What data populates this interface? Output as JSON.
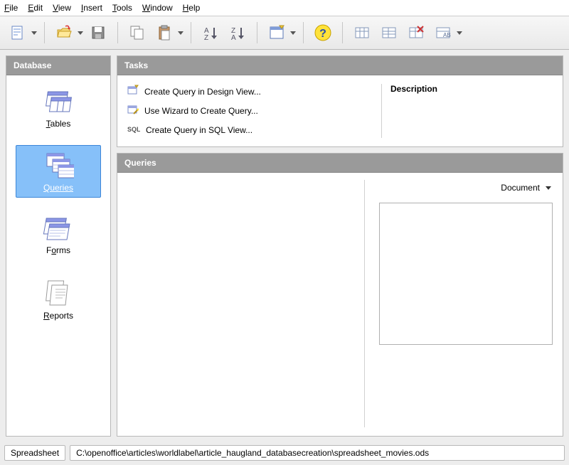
{
  "menu": {
    "file": "File",
    "edit": "Edit",
    "view": "View",
    "insert": "Insert",
    "tools": "Tools",
    "window": "Window",
    "help": "Help"
  },
  "sidebar": {
    "header": "Database",
    "tables": "Tables",
    "queries": "Queries",
    "forms": "Forms",
    "reports": "Reports"
  },
  "tasks": {
    "header": "Tasks",
    "items": [
      "Create Query in Design View...",
      "Use Wizard to Create Query...",
      "Create Query in SQL View..."
    ],
    "description_label": "Description",
    "description_text": ""
  },
  "queries_panel": {
    "header": "Queries",
    "doc_dropdown": "Document"
  },
  "status": {
    "type": "Spreadsheet",
    "path": "C:\\openoffice\\articles\\worldlabel\\article_haugland_databasecreation\\spreadsheet_movies.ods"
  }
}
